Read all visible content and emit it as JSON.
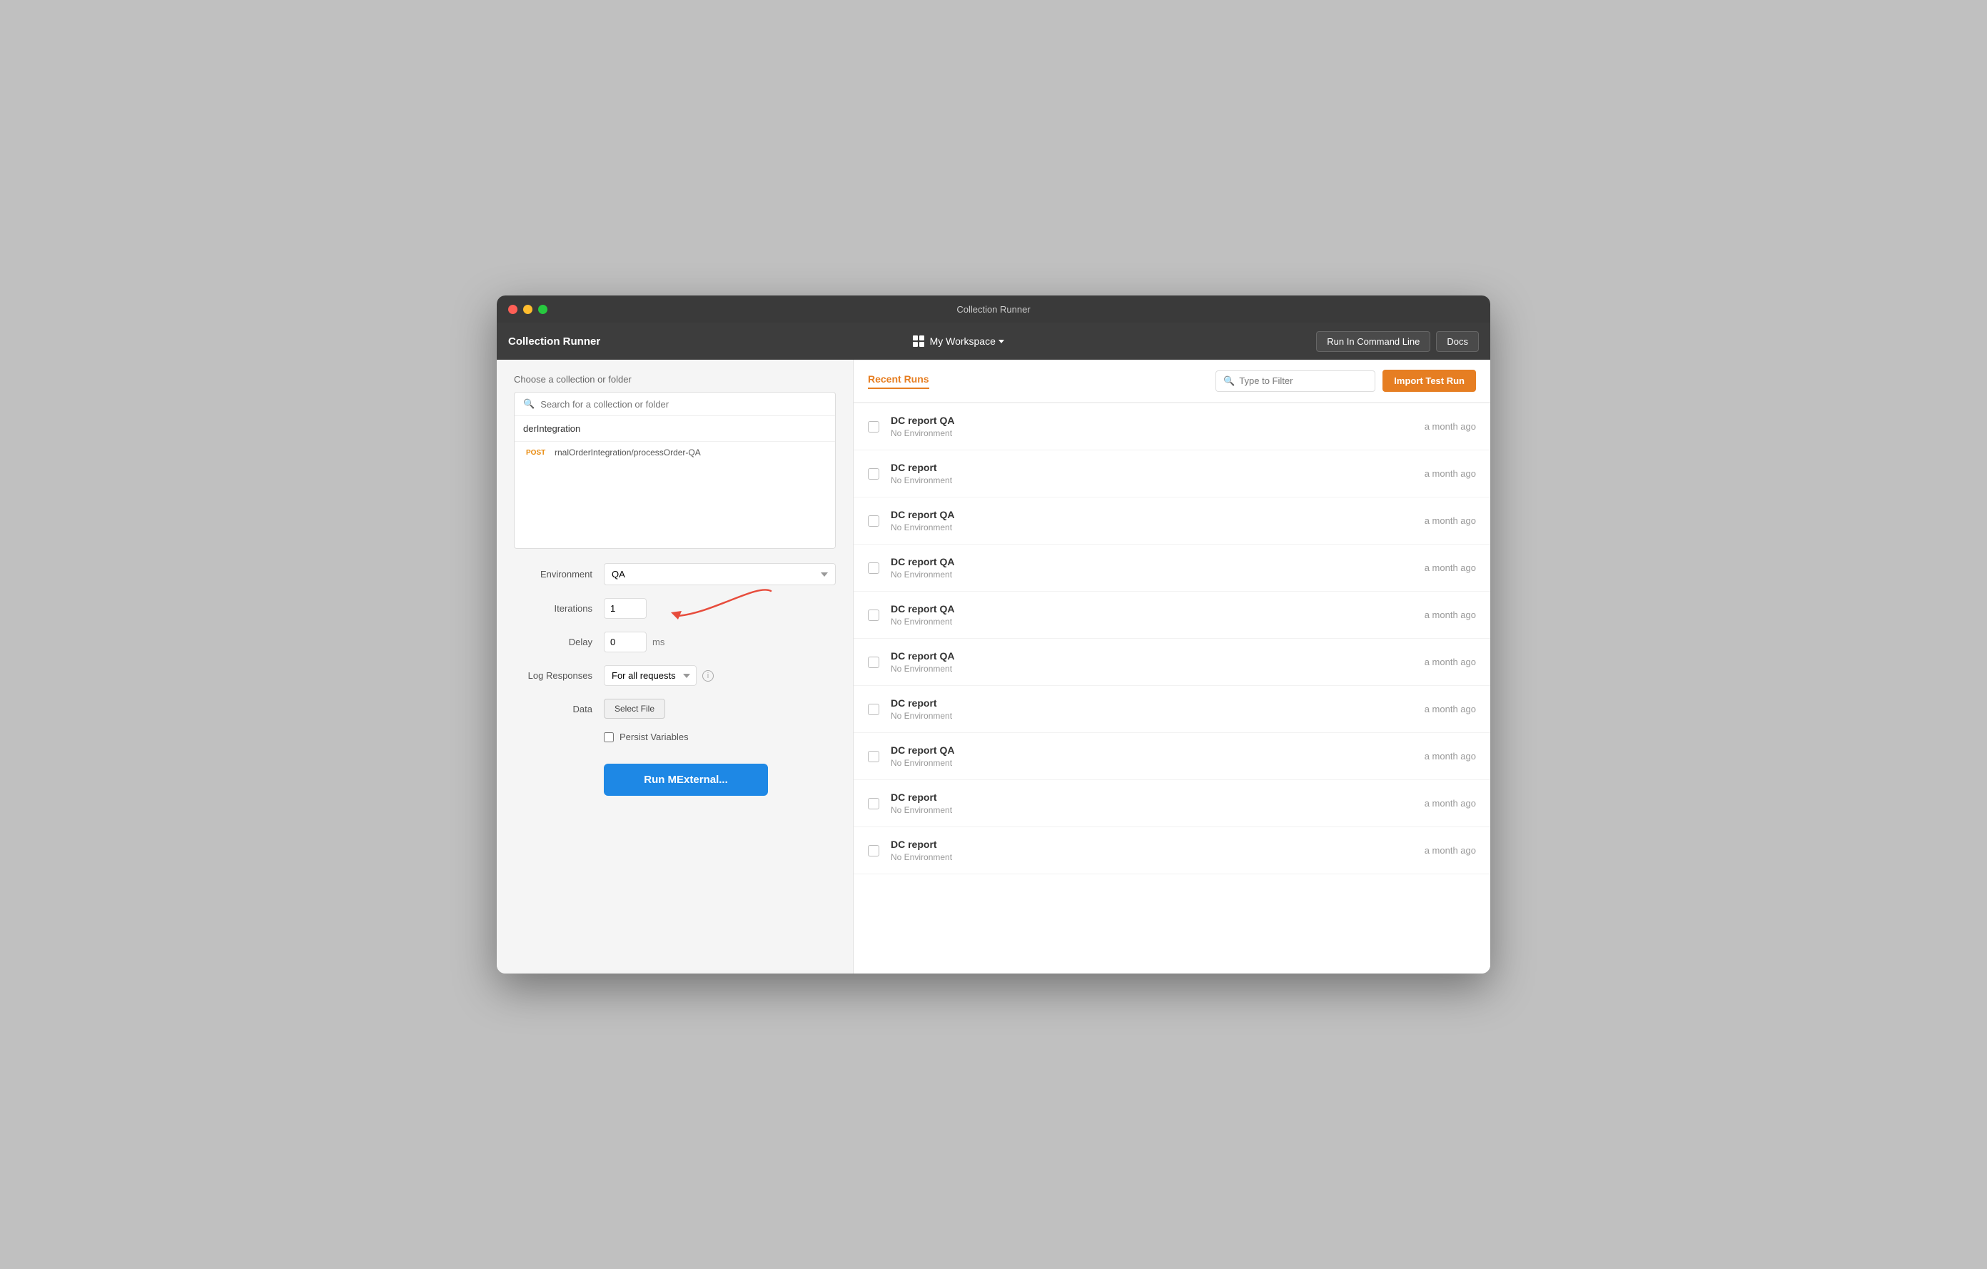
{
  "window": {
    "title": "Collection Runner"
  },
  "titlebar": {
    "title": "Collection Runner"
  },
  "toolbar": {
    "app_name": "Collection Runner",
    "workspace_label": "My Workspace",
    "run_cmd_line": "Run In Command Line",
    "docs": "Docs"
  },
  "left_panel": {
    "choose_label": "Choose a collection or folder",
    "search_placeholder": "Search for a collection or folder",
    "collection_name": "derIntegration",
    "sub_item_method": "POST",
    "sub_item_name": "rnalOrderIntegration/processOrder-QA",
    "environment_label": "Environment",
    "environment_value": "QA",
    "iterations_label": "Iterations",
    "iterations_value": "1",
    "delay_label": "Delay",
    "delay_value": "0",
    "delay_unit": "ms",
    "log_responses_label": "Log Responses",
    "log_responses_value": "For all requests",
    "data_label": "Data",
    "select_file_label": "Select File",
    "persist_variables_label": "Persist Variables",
    "run_button_label": "Run      MExternal..."
  },
  "right_panel": {
    "tab_recent_runs": "Recent Runs",
    "filter_placeholder": "Type to Filter",
    "import_btn_label": "Import Test Run",
    "runs": [
      {
        "name": "DC report QA",
        "env": "No Environment",
        "time": "a month ago"
      },
      {
        "name": "DC report",
        "env": "No Environment",
        "time": "a month ago"
      },
      {
        "name": "DC report QA",
        "env": "No Environment",
        "time": "a month ago"
      },
      {
        "name": "DC report QA",
        "env": "No Environment",
        "time": "a month ago"
      },
      {
        "name": "DC report QA",
        "env": "No Environment",
        "time": "a month ago"
      },
      {
        "name": "DC report QA",
        "env": "No Environment",
        "time": "a month ago"
      },
      {
        "name": "DC report",
        "env": "No Environment",
        "time": "a month ago"
      },
      {
        "name": "DC report QA",
        "env": "No Environment",
        "time": "a month ago"
      },
      {
        "name": "DC report",
        "env": "No Environment",
        "time": "a month ago"
      },
      {
        "name": "DC report",
        "env": "No Environment",
        "time": "a month ago"
      }
    ]
  },
  "colors": {
    "orange_accent": "#e67e22",
    "blue_run": "#1e88e5",
    "post_color": "#e8890b"
  }
}
